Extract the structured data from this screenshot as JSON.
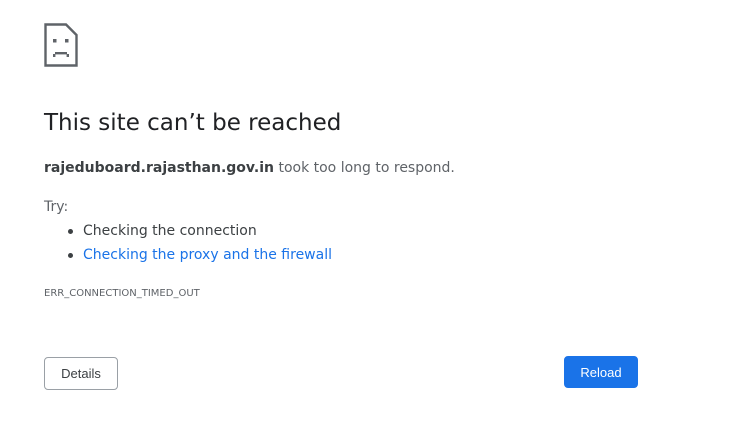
{
  "icon": "sad-page-icon",
  "title": "This site can’t be reached",
  "summary": {
    "host": "rajeduboard.rajasthan.gov.in",
    "message": " took too long to respond."
  },
  "try_label": "Try:",
  "suggestions": [
    {
      "label": "Checking the connection",
      "is_link": false
    },
    {
      "label": "Checking the proxy and the firewall",
      "is_link": true
    }
  ],
  "error_code": "ERR_CONNECTION_TIMED_OUT",
  "buttons": {
    "details_label": "Details",
    "reload_label": "Reload"
  },
  "colors": {
    "accent": "#1a73e8",
    "text_primary": "#202124",
    "text_secondary": "#5f6368"
  }
}
